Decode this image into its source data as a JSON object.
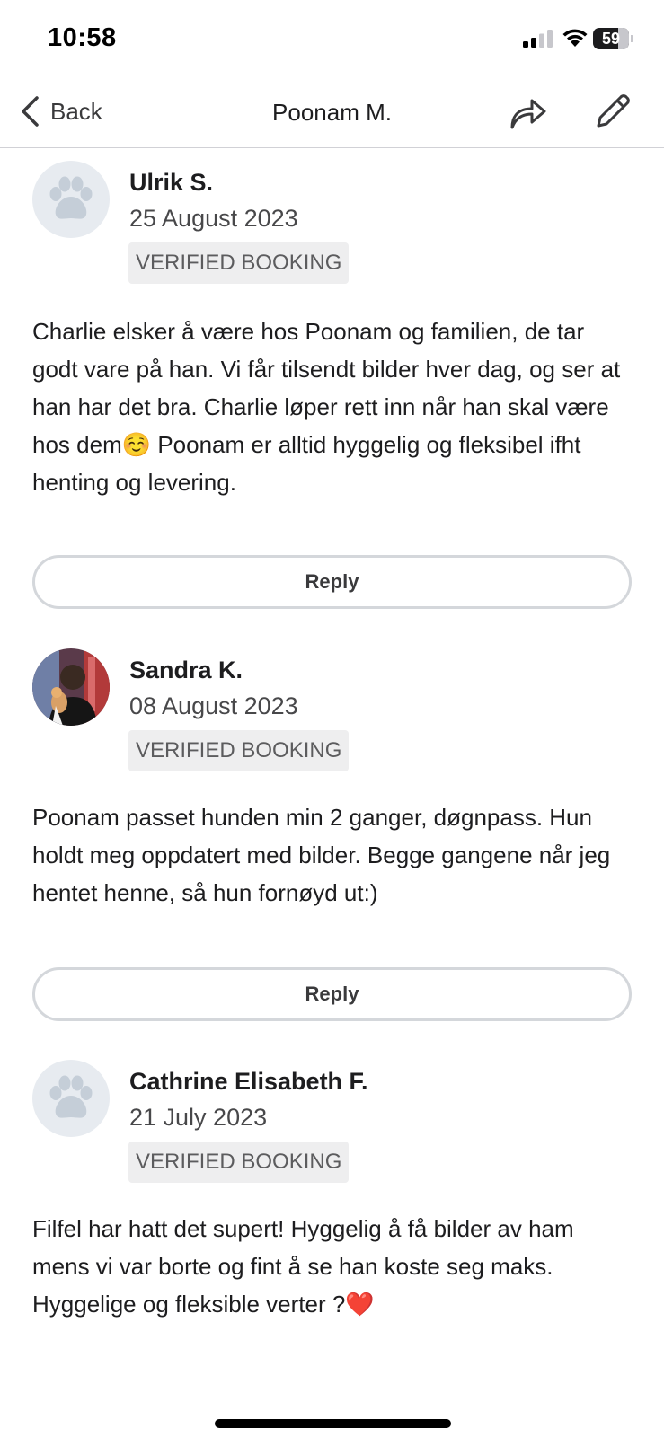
{
  "status_bar": {
    "time": "10:58",
    "battery": "59",
    "icons": [
      "signal-icon",
      "wifi-icon",
      "battery-icon"
    ]
  },
  "nav": {
    "back_label": "Back",
    "title": "Poonam M.",
    "icons": [
      "chevron-left-icon",
      "share-icon",
      "edit-pencil-icon"
    ]
  },
  "reviews": [
    {
      "name": "Ulrik S.",
      "date": "25 August 2023",
      "badge": "VERIFIED BOOKING",
      "avatar": "paw-placeholder",
      "text": "Charlie elsker å være hos Poonam og familien, de tar godt vare på han. Vi får tilsendt bilder hver dag, og ser at han har det bra. Charlie løper rett inn når han skal være hos dem☺️ Poonam er alltid hyggelig og fleksibel ifht henting og levering.",
      "reply_label": "Reply"
    },
    {
      "name": "Sandra K.",
      "date": "08 August 2023",
      "badge": "VERIFIED BOOKING",
      "avatar": "photo",
      "text": "Poonam passet hunden min 2 ganger, døgnpass. Hun holdt meg oppdatert med bilder. Begge gangene når jeg hentet henne, så hun fornøyd ut:)",
      "reply_label": "Reply"
    },
    {
      "name": "Cathrine Elisabeth F.",
      "date": "21 July 2023",
      "badge": "VERIFIED BOOKING",
      "avatar": "paw-placeholder",
      "text": "Filfel har hatt det supert! Hyggelig å få bilder av ham mens vi var borte og fint å se han koste seg maks. Hyggelige og fleksible verter ?❤️"
    }
  ]
}
